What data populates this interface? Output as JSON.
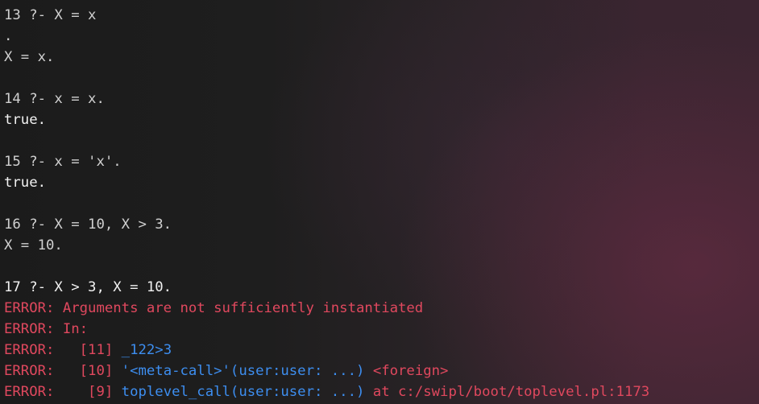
{
  "terminal": {
    "lines": [
      {
        "type": "prompt",
        "text": "13 ?- X = x"
      },
      {
        "type": "output",
        "text": "."
      },
      {
        "type": "output",
        "text": "X = x."
      },
      {
        "type": "blank",
        "text": ""
      },
      {
        "type": "prompt",
        "text": "14 ?- x = x."
      },
      {
        "type": "result",
        "text": "true."
      },
      {
        "type": "blank",
        "text": ""
      },
      {
        "type": "prompt",
        "text": "15 ?- x = 'x'."
      },
      {
        "type": "result",
        "text": "true."
      },
      {
        "type": "blank",
        "text": ""
      },
      {
        "type": "prompt",
        "text": "16 ?- X = 10, X > 3."
      },
      {
        "type": "output",
        "text": "X = 10."
      },
      {
        "type": "blank",
        "text": ""
      },
      {
        "type": "prompt",
        "text": "17 ?- X > 3, X = 10."
      }
    ],
    "errors": {
      "e1": "ERROR: Arguments are not sufficiently instantiated",
      "e2": "ERROR: In:",
      "e3_prefix": "ERROR:   [11] ",
      "e3_goal": "_122>3",
      "e4_prefix": "ERROR:   [10] ",
      "e4_goal": "'<meta-call>'(user:user: ...)",
      "e4_space": " ",
      "e4_suffix": "<foreign>",
      "e5_prefix": "ERROR:    [9] ",
      "e5_goal": "toplevel_call(user:user: ...)",
      "e5_at": " at ",
      "e5_location": "c:/swipl/boot/toplevel.pl:1173"
    },
    "colors": {
      "error": "#e0485e",
      "goal": "#3d8ef0",
      "text": "#d8d8d8",
      "result": "#f2f2f2"
    }
  }
}
